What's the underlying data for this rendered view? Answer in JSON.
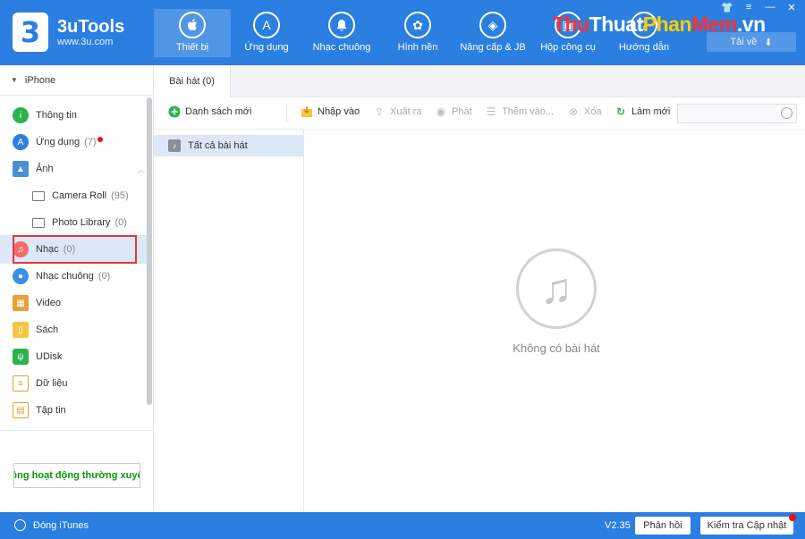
{
  "app": {
    "name": "3uTools",
    "url": "www.3u.com",
    "logo_mark": "3"
  },
  "nav": [
    {
      "label": "Thiết bị",
      "icon": "apple-icon",
      "glyph": ""
    },
    {
      "label": "Ứng dụng",
      "icon": "appstore-icon",
      "glyph": "A"
    },
    {
      "label": "Nhạc chuông",
      "icon": "bell-icon",
      "glyph": "🔔"
    },
    {
      "label": "Hình nền",
      "icon": "flower-icon",
      "glyph": "✿"
    },
    {
      "label": "Nâng cấp & JB",
      "icon": "dropbox-icon",
      "glyph": "◈"
    },
    {
      "label": "Hộp công cụ",
      "icon": "toolbox-icon",
      "glyph": "▣"
    },
    {
      "label": "Hướng dẫn",
      "icon": "guide-icon",
      "glyph": "?"
    }
  ],
  "watermark": {
    "part1": "Thu",
    "part2": "Thuat",
    "part3": "Phan",
    "part4": "Mem",
    "part5": ".vn"
  },
  "header": {
    "download_label": "Tải về",
    "download_icon": "⬇",
    "win_shirt": "👕",
    "win_menu": "≡",
    "win_min": "—",
    "win_close": "✕"
  },
  "sidebar": {
    "device": "iPhone",
    "items": [
      {
        "label": "Thông tin",
        "count": ""
      },
      {
        "label": "Ứng dụng",
        "count": "(7)"
      },
      {
        "label": "Ảnh",
        "count": ""
      },
      {
        "label": "Camera Roll",
        "count": "(95)"
      },
      {
        "label": "Photo Library",
        "count": "(0)"
      },
      {
        "label": "Nhạc",
        "count": "(0)"
      },
      {
        "label": "Nhạc chuông",
        "count": "(0)"
      },
      {
        "label": "Video",
        "count": ""
      },
      {
        "label": "Sách",
        "count": ""
      },
      {
        "label": "UDisk",
        "count": ""
      },
      {
        "label": "Dữ liệu",
        "count": ""
      },
      {
        "label": "Tập tin",
        "count": ""
      }
    ],
    "banner": "ông hoạt động thường xuyê"
  },
  "main": {
    "tab": "Bài hát (0)",
    "toolbar": {
      "new_playlist": "Danh sách mới",
      "import": "Nhập vào",
      "export": "Xuất ra",
      "play": "Phát",
      "add_to": "Thêm vào...",
      "delete": "Xóa",
      "refresh": "Làm mới"
    },
    "playlist_all": "Tất cả bài hát",
    "empty_text": "Không có bài hát",
    "empty_glyph": "♫"
  },
  "footer": {
    "itunes": "Đóng iTunes",
    "version": "V2.35",
    "feedback": "Phản hồi",
    "check_update": "Kiểm tra Cập nhật"
  },
  "colors": {
    "accent": "#2a7fe0",
    "highlight": "#e03a3a",
    "selected_bg": "#dce8f7"
  }
}
